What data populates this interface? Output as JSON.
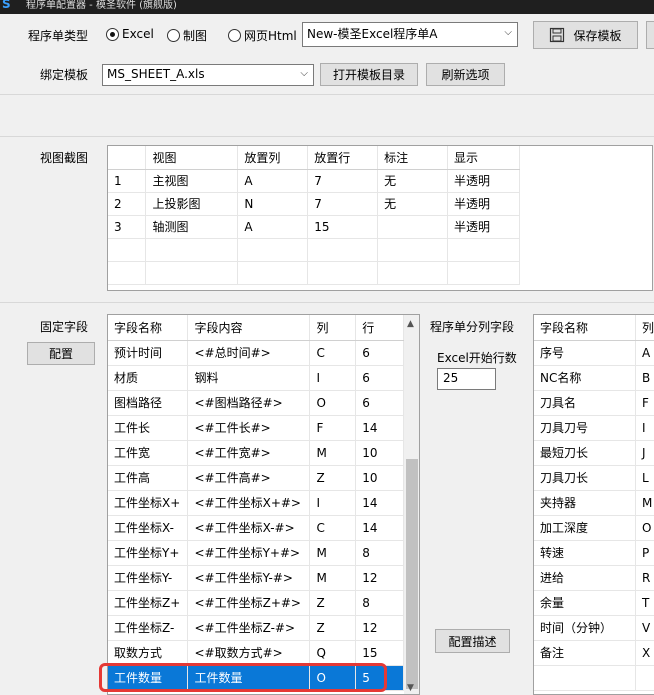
{
  "window": {
    "title": "程序单配置器 - 模圣软件 (旗舰版)"
  },
  "top": {
    "program_type_label": "程序单类型",
    "radios": [
      {
        "label": "Excel",
        "checked": true
      },
      {
        "label": "制图",
        "checked": false
      },
      {
        "label": "网页Html",
        "checked": false
      }
    ],
    "template_combo": "New-模圣Excel程序单A",
    "save_template": "保存模板",
    "bind_label": "绑定模板",
    "bind_combo": "MS_SHEET_A.xls",
    "open_dir": "打开模板目录",
    "refresh": "刷新选项"
  },
  "views": {
    "label": "视图截图",
    "headers": [
      "",
      "视图",
      "放置列",
      "放置行",
      "标注",
      "显示"
    ],
    "rows": [
      [
        "1",
        "主视图",
        "A",
        "7",
        "无",
        "半透明"
      ],
      [
        "2",
        "上投影图",
        "N",
        "7",
        "无",
        "半透明"
      ],
      [
        "3",
        "轴测图",
        "A",
        "15",
        "",
        "半透明"
      ]
    ]
  },
  "fixed": {
    "label": "固定字段",
    "config_button": "配置",
    "headers": [
      "字段名称",
      "字段内容",
      "列",
      "行"
    ],
    "rows": [
      [
        "预计时间",
        "<#总时间#>",
        "C",
        "6"
      ],
      [
        "材质",
        "钢料",
        "I",
        "6"
      ],
      [
        "图档路径",
        "<#图档路径#>",
        "O",
        "6"
      ],
      [
        "工件长",
        "<#工件长#>",
        "F",
        "14"
      ],
      [
        "工件宽",
        "<#工件宽#>",
        "M",
        "10"
      ],
      [
        "工件高",
        "<#工件高#>",
        "Z",
        "10"
      ],
      [
        "工件坐标X+",
        "<#工件坐标X+#>",
        "I",
        "14"
      ],
      [
        "工件坐标X-",
        "<#工件坐标X-#>",
        "C",
        "14"
      ],
      [
        "工件坐标Y+",
        "<#工件坐标Y+#>",
        "M",
        "8"
      ],
      [
        "工件坐标Y-",
        "<#工件坐标Y-#>",
        "M",
        "12"
      ],
      [
        "工件坐标Z+",
        "<#工件坐标Z+#>",
        "Z",
        "8"
      ],
      [
        "工件坐标Z-",
        "<#工件坐标Z-#>",
        "Z",
        "12"
      ],
      [
        "取数方式",
        "<#取数方式#>",
        "Q",
        "15"
      ],
      [
        "工件数量",
        "工件数量",
        "O",
        "5"
      ]
    ],
    "selected_index": 13
  },
  "split": {
    "label": "程序单分列字段",
    "start_row_label": "Excel开始行数",
    "start_row_value": "25",
    "config_desc": "配置描述",
    "headers": [
      "字段名称",
      "列号"
    ],
    "rows": [
      [
        "序号",
        "A"
      ],
      [
        "NC名称",
        "B"
      ],
      [
        "刀具名",
        "F"
      ],
      [
        "刀具刀号",
        "I"
      ],
      [
        "最短刀长",
        "J"
      ],
      [
        "刀具刀长",
        "L"
      ],
      [
        "夹持器",
        "M"
      ],
      [
        "加工深度",
        "O"
      ],
      [
        "转速",
        "P"
      ],
      [
        "进给",
        "R"
      ],
      [
        "余量",
        "T"
      ],
      [
        "时间（分钟）",
        "V"
      ],
      [
        "备注",
        "X"
      ]
    ]
  }
}
